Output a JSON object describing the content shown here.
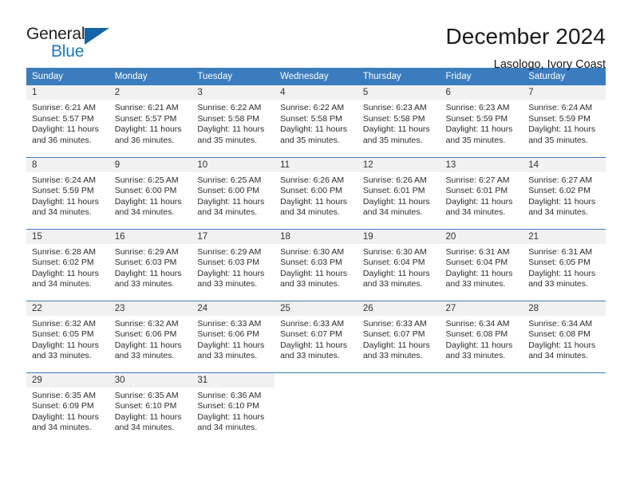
{
  "logo": {
    "word_primary": "General",
    "word_secondary": "Blue",
    "icon": "triangle-icon",
    "primary_color": "#231f20",
    "secondary_color": "#1a77c6",
    "triangle_color": "#1565a8"
  },
  "header": {
    "title": "December 2024",
    "subtitle": "Lasologo, Ivory Coast"
  },
  "theme": {
    "header_bg": "#3b7cbf",
    "header_text": "#ffffff",
    "daynum_bg": "#f1f1f1",
    "cell_bg": "#ffffff",
    "grid_line": "#3b7cbf"
  },
  "weekdays": [
    "Sunday",
    "Monday",
    "Tuesday",
    "Wednesday",
    "Thursday",
    "Friday",
    "Saturday"
  ],
  "weeks": [
    [
      {
        "day": "1",
        "sunrise": "Sunrise: 6:21 AM",
        "sunset": "Sunset: 5:57 PM",
        "daylight_line1": "Daylight: 11 hours",
        "daylight_line2": "and 36 minutes."
      },
      {
        "day": "2",
        "sunrise": "Sunrise: 6:21 AM",
        "sunset": "Sunset: 5:57 PM",
        "daylight_line1": "Daylight: 11 hours",
        "daylight_line2": "and 36 minutes."
      },
      {
        "day": "3",
        "sunrise": "Sunrise: 6:22 AM",
        "sunset": "Sunset: 5:58 PM",
        "daylight_line1": "Daylight: 11 hours",
        "daylight_line2": "and 35 minutes."
      },
      {
        "day": "4",
        "sunrise": "Sunrise: 6:22 AM",
        "sunset": "Sunset: 5:58 PM",
        "daylight_line1": "Daylight: 11 hours",
        "daylight_line2": "and 35 minutes."
      },
      {
        "day": "5",
        "sunrise": "Sunrise: 6:23 AM",
        "sunset": "Sunset: 5:58 PM",
        "daylight_line1": "Daylight: 11 hours",
        "daylight_line2": "and 35 minutes."
      },
      {
        "day": "6",
        "sunrise": "Sunrise: 6:23 AM",
        "sunset": "Sunset: 5:59 PM",
        "daylight_line1": "Daylight: 11 hours",
        "daylight_line2": "and 35 minutes."
      },
      {
        "day": "7",
        "sunrise": "Sunrise: 6:24 AM",
        "sunset": "Sunset: 5:59 PM",
        "daylight_line1": "Daylight: 11 hours",
        "daylight_line2": "and 35 minutes."
      }
    ],
    [
      {
        "day": "8",
        "sunrise": "Sunrise: 6:24 AM",
        "sunset": "Sunset: 5:59 PM",
        "daylight_line1": "Daylight: 11 hours",
        "daylight_line2": "and 34 minutes."
      },
      {
        "day": "9",
        "sunrise": "Sunrise: 6:25 AM",
        "sunset": "Sunset: 6:00 PM",
        "daylight_line1": "Daylight: 11 hours",
        "daylight_line2": "and 34 minutes."
      },
      {
        "day": "10",
        "sunrise": "Sunrise: 6:25 AM",
        "sunset": "Sunset: 6:00 PM",
        "daylight_line1": "Daylight: 11 hours",
        "daylight_line2": "and 34 minutes."
      },
      {
        "day": "11",
        "sunrise": "Sunrise: 6:26 AM",
        "sunset": "Sunset: 6:00 PM",
        "daylight_line1": "Daylight: 11 hours",
        "daylight_line2": "and 34 minutes."
      },
      {
        "day": "12",
        "sunrise": "Sunrise: 6:26 AM",
        "sunset": "Sunset: 6:01 PM",
        "daylight_line1": "Daylight: 11 hours",
        "daylight_line2": "and 34 minutes."
      },
      {
        "day": "13",
        "sunrise": "Sunrise: 6:27 AM",
        "sunset": "Sunset: 6:01 PM",
        "daylight_line1": "Daylight: 11 hours",
        "daylight_line2": "and 34 minutes."
      },
      {
        "day": "14",
        "sunrise": "Sunrise: 6:27 AM",
        "sunset": "Sunset: 6:02 PM",
        "daylight_line1": "Daylight: 11 hours",
        "daylight_line2": "and 34 minutes."
      }
    ],
    [
      {
        "day": "15",
        "sunrise": "Sunrise: 6:28 AM",
        "sunset": "Sunset: 6:02 PM",
        "daylight_line1": "Daylight: 11 hours",
        "daylight_line2": "and 34 minutes."
      },
      {
        "day": "16",
        "sunrise": "Sunrise: 6:29 AM",
        "sunset": "Sunset: 6:03 PM",
        "daylight_line1": "Daylight: 11 hours",
        "daylight_line2": "and 33 minutes."
      },
      {
        "day": "17",
        "sunrise": "Sunrise: 6:29 AM",
        "sunset": "Sunset: 6:03 PM",
        "daylight_line1": "Daylight: 11 hours",
        "daylight_line2": "and 33 minutes."
      },
      {
        "day": "18",
        "sunrise": "Sunrise: 6:30 AM",
        "sunset": "Sunset: 6:03 PM",
        "daylight_line1": "Daylight: 11 hours",
        "daylight_line2": "and 33 minutes."
      },
      {
        "day": "19",
        "sunrise": "Sunrise: 6:30 AM",
        "sunset": "Sunset: 6:04 PM",
        "daylight_line1": "Daylight: 11 hours",
        "daylight_line2": "and 33 minutes."
      },
      {
        "day": "20",
        "sunrise": "Sunrise: 6:31 AM",
        "sunset": "Sunset: 6:04 PM",
        "daylight_line1": "Daylight: 11 hours",
        "daylight_line2": "and 33 minutes."
      },
      {
        "day": "21",
        "sunrise": "Sunrise: 6:31 AM",
        "sunset": "Sunset: 6:05 PM",
        "daylight_line1": "Daylight: 11 hours",
        "daylight_line2": "and 33 minutes."
      }
    ],
    [
      {
        "day": "22",
        "sunrise": "Sunrise: 6:32 AM",
        "sunset": "Sunset: 6:05 PM",
        "daylight_line1": "Daylight: 11 hours",
        "daylight_line2": "and 33 minutes."
      },
      {
        "day": "23",
        "sunrise": "Sunrise: 6:32 AM",
        "sunset": "Sunset: 6:06 PM",
        "daylight_line1": "Daylight: 11 hours",
        "daylight_line2": "and 33 minutes."
      },
      {
        "day": "24",
        "sunrise": "Sunrise: 6:33 AM",
        "sunset": "Sunset: 6:06 PM",
        "daylight_line1": "Daylight: 11 hours",
        "daylight_line2": "and 33 minutes."
      },
      {
        "day": "25",
        "sunrise": "Sunrise: 6:33 AM",
        "sunset": "Sunset: 6:07 PM",
        "daylight_line1": "Daylight: 11 hours",
        "daylight_line2": "and 33 minutes."
      },
      {
        "day": "26",
        "sunrise": "Sunrise: 6:33 AM",
        "sunset": "Sunset: 6:07 PM",
        "daylight_line1": "Daylight: 11 hours",
        "daylight_line2": "and 33 minutes."
      },
      {
        "day": "27",
        "sunrise": "Sunrise: 6:34 AM",
        "sunset": "Sunset: 6:08 PM",
        "daylight_line1": "Daylight: 11 hours",
        "daylight_line2": "and 33 minutes."
      },
      {
        "day": "28",
        "sunrise": "Sunrise: 6:34 AM",
        "sunset": "Sunset: 6:08 PM",
        "daylight_line1": "Daylight: 11 hours",
        "daylight_line2": "and 34 minutes."
      }
    ],
    [
      {
        "day": "29",
        "sunrise": "Sunrise: 6:35 AM",
        "sunset": "Sunset: 6:09 PM",
        "daylight_line1": "Daylight: 11 hours",
        "daylight_line2": "and 34 minutes."
      },
      {
        "day": "30",
        "sunrise": "Sunrise: 6:35 AM",
        "sunset": "Sunset: 6:10 PM",
        "daylight_line1": "Daylight: 11 hours",
        "daylight_line2": "and 34 minutes."
      },
      {
        "day": "31",
        "sunrise": "Sunrise: 6:36 AM",
        "sunset": "Sunset: 6:10 PM",
        "daylight_line1": "Daylight: 11 hours",
        "daylight_line2": "and 34 minutes."
      },
      {
        "day": "",
        "sunrise": "",
        "sunset": "",
        "daylight_line1": "",
        "daylight_line2": ""
      },
      {
        "day": "",
        "sunrise": "",
        "sunset": "",
        "daylight_line1": "",
        "daylight_line2": ""
      },
      {
        "day": "",
        "sunrise": "",
        "sunset": "",
        "daylight_line1": "",
        "daylight_line2": ""
      },
      {
        "day": "",
        "sunrise": "",
        "sunset": "",
        "daylight_line1": "",
        "daylight_line2": ""
      }
    ]
  ]
}
